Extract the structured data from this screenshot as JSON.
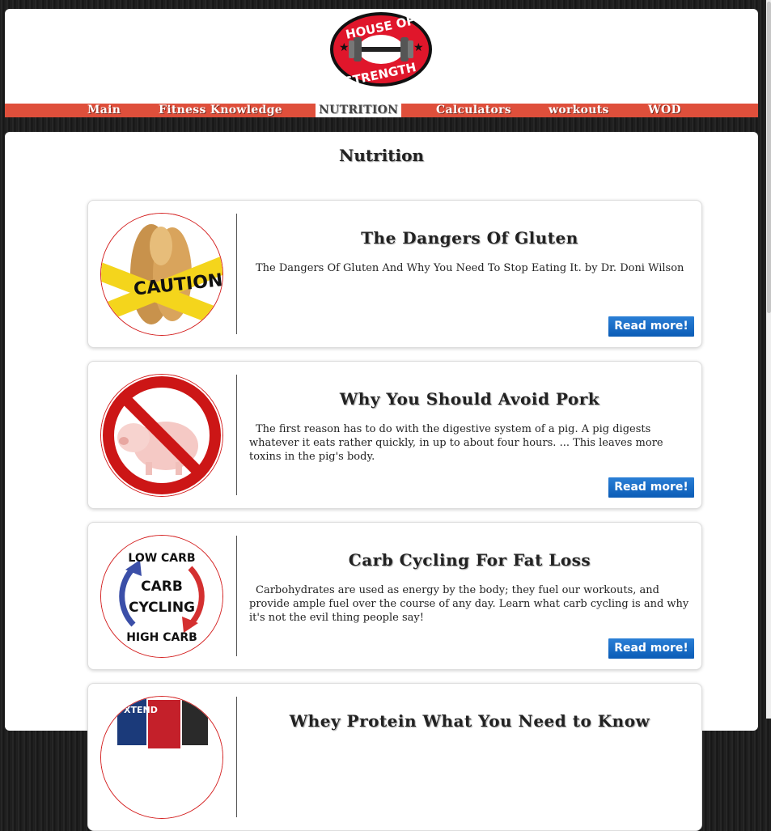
{
  "logo": {
    "line1": "HOUSE OF",
    "line2": "STRENGTH"
  },
  "nav": {
    "items": [
      "Main",
      "Fitness Knowledge",
      "NUTRITION",
      "Calculators",
      "workouts",
      "WOD"
    ],
    "active": "NUTRITION"
  },
  "page": {
    "title": "Nutrition"
  },
  "articles": [
    {
      "title": "The Dangers Of Gluten",
      "description": "The Dangers Of Gluten And Why You Need To Stop Eating It. by Dr. Doni Wilson",
      "button": "Read more!",
      "image_text": "CAUTION"
    },
    {
      "title": "Why You Should Avoid Pork",
      "description": "The first reason has to do with the digestive system of a pig. A pig digests whatever it eats rather quickly, in up to about four hours. ... This leaves more toxins in the pig's body.",
      "button": "Read more!"
    },
    {
      "title": "Carb Cycling For Fat Loss",
      "description": "Carbohydrates are used as energy by the body; they fuel our workouts, and provide ample fuel over the course of any day. Learn what carb cycling is and why it's not the evil thing people say!",
      "button": "Read more!",
      "image_text": [
        "LOW CARB",
        "CARB",
        "CYCLING",
        "HIGH CARB"
      ]
    },
    {
      "title": "Whey Protein What You Need to Know",
      "image_text": "XTEND"
    }
  ],
  "colors": {
    "nav_bg": "#df4f3b",
    "button": "#0b5cb6",
    "logo_red": "#e0162b"
  }
}
